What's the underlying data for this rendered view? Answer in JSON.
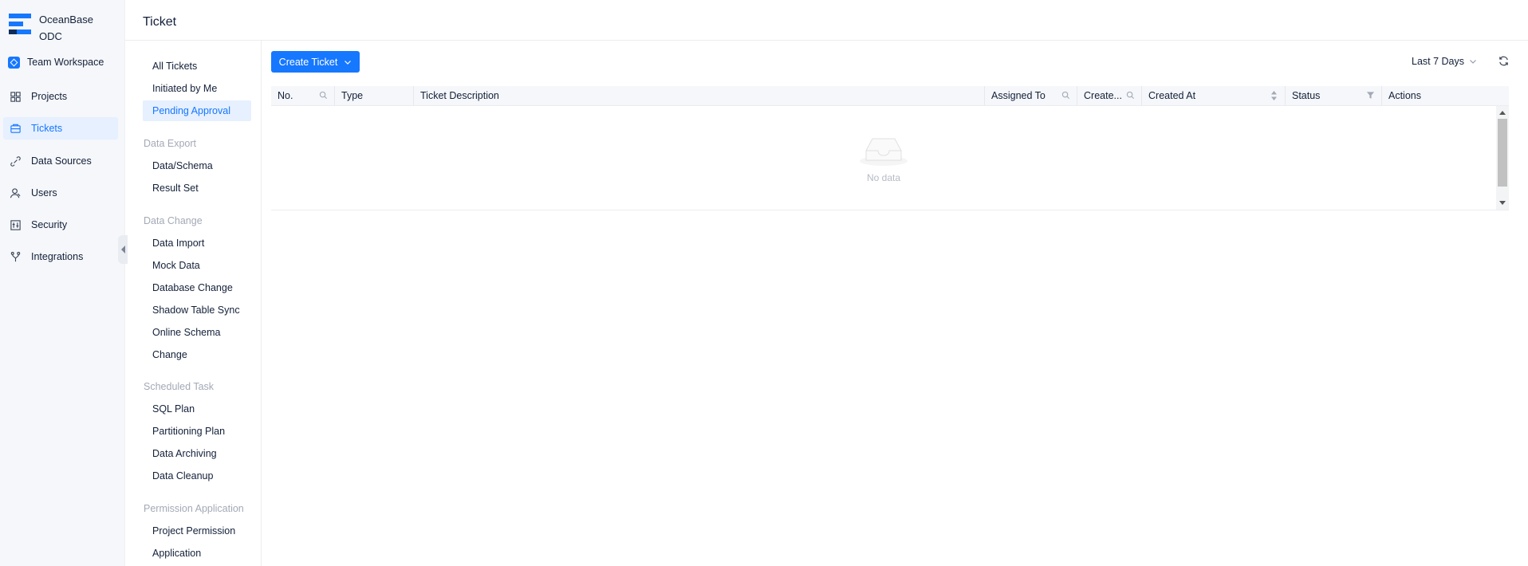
{
  "app": {
    "brand_line1": "OceanBase",
    "brand_line2": "ODC",
    "workspace": "Team Workspace"
  },
  "nav": [
    {
      "label": "Projects",
      "icon": "projects-icon"
    },
    {
      "label": "Tickets",
      "icon": "tickets-icon",
      "active": true
    },
    {
      "label": "Data Sources",
      "icon": "datasources-icon"
    },
    {
      "label": "Users",
      "icon": "users-icon"
    },
    {
      "label": "Security",
      "icon": "security-icon"
    },
    {
      "label": "Integrations",
      "icon": "integrations-icon"
    }
  ],
  "header": {
    "title": "Ticket"
  },
  "categories": {
    "top": [
      "All Tickets",
      "Initiated by Me",
      "Pending Approval"
    ],
    "data_export": {
      "heading": "Data Export",
      "items": [
        "Data/Schema",
        "Result Set"
      ]
    },
    "data_change": {
      "heading": "Data Change",
      "items": [
        "Data Import",
        "Mock Data",
        "Database Change",
        "Shadow Table Sync",
        "Online Schema",
        "Change"
      ]
    },
    "scheduled": {
      "heading": "Scheduled Task",
      "items": [
        "SQL Plan",
        "Partitioning Plan",
        "Data Archiving",
        "Data Cleanup"
      ]
    },
    "permission": {
      "heading": "Permission Application",
      "items": [
        "Project Permission",
        "Application"
      ]
    }
  },
  "toolbar": {
    "create_label": "Create Ticket",
    "range_label": "Last 7 Days"
  },
  "table": {
    "columns": [
      "No.",
      "Type",
      "Ticket Description",
      "Assigned To",
      "Create...",
      "Created At",
      "Status",
      "Actions"
    ],
    "empty_text": "No data"
  },
  "colors": {
    "accent": "#1677ff",
    "active_bg": "#e6f0ff"
  }
}
